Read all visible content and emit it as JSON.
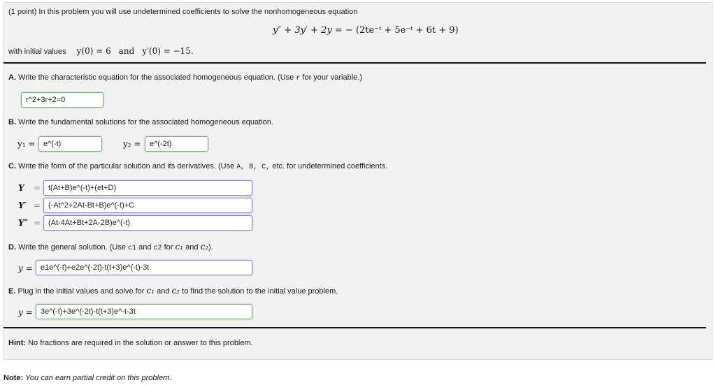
{
  "intro": {
    "points": "(1 point)",
    "text": "In this problem you will use undetermined coefficients to solve the nonhomogeneous equation",
    "equation": {
      "lhs": "y″ + 3y′ + 2y",
      "rhs": "− (2te⁻ᵗ + 5e⁻ᵗ + 6t + 9)"
    },
    "initial_values_label": "with initial values",
    "initial_values": {
      "y0": "y(0) = 6",
      "and": "and",
      "yp0": "y′(0) = −15."
    }
  },
  "parts": {
    "A": {
      "label": "A.",
      "text_before": "Write the characteristic equation for the associated homogeneous equation. (Use",
      "var": "r",
      "text_after": "for your variable.)",
      "answer": "r^2+3r+2=0",
      "status": "correct"
    },
    "B": {
      "label": "B.",
      "text": "Write the fundamental solutions for the associated homogeneous equation.",
      "y1_label": "y₁ =",
      "y1_answer": "e^(-t)",
      "y2_label": "y₂ =",
      "y2_answer": "e^(-2t)",
      "status": "correct"
    },
    "C": {
      "label": "C.",
      "text_before": "Write the form of the particular solution and its derivatives. (Use",
      "coeffs": "A, B, C,",
      "text_after": "etc. for undetermined coefficients.",
      "rows": [
        {
          "label": "Y",
          "eq": "=",
          "answer": "t(At+B)e^(-t)+(et+D)"
        },
        {
          "label": "Y′",
          "eq": "=",
          "answer": "(-At^2+2At-Bt+B)e^(-t)+C"
        },
        {
          "label": "Y″",
          "eq": "=",
          "answer": "(At-4At+Bt+2A-2B)e^(-t)"
        }
      ],
      "status": "pending"
    },
    "D": {
      "label": "D.",
      "text_before": "Write the general solution. (Use",
      "c1": "c1",
      "and1": "and",
      "c2": "c2",
      "for": "for",
      "c1_math": "c₁",
      "and2": "and",
      "c2_math": "c₂",
      "close": ").",
      "y_label": "y =",
      "answer": "e1e^(-t)+e2e^(-2t)-t(t+3)e^(-t)-3t",
      "status": "pending"
    },
    "E": {
      "label": "E.",
      "text_before": "Plug in the initial values and solve for",
      "c1_math": "c₁",
      "and": "and",
      "c2_math": "c₂",
      "text_after": "to find the solution to the initial value problem.",
      "y_label": "y =",
      "answer": "3e^(-t)+3e^(-2t)-t(t+3)e^-t-3t",
      "status": "correct"
    }
  },
  "hint": {
    "label": "Hint:",
    "text": "No fractions are required in the solution or answer to this problem."
  },
  "note": {
    "label": "Note:",
    "text": "You can earn partial credit on this problem."
  },
  "colors": {
    "correct_border": "#6fb26f",
    "pending_border": "#8a85d6",
    "panel_bg": "#f2f2f2"
  }
}
